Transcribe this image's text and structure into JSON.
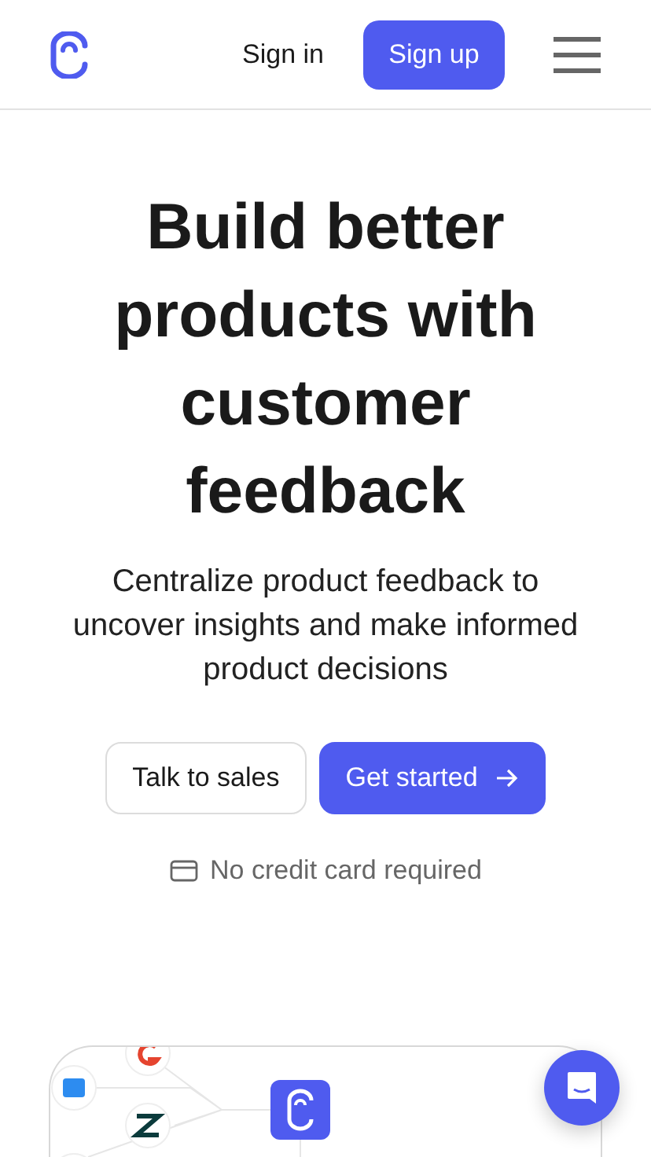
{
  "header": {
    "sign_in": "Sign in",
    "sign_up": "Sign up"
  },
  "hero": {
    "title": "Build better products with customer feedback",
    "subtitle": "Centralize product feedback to uncover insights and make informed product decisions",
    "buttons": [
      {
        "label": "Talk to sales",
        "kind": "secondary"
      },
      {
        "label": "Get started",
        "kind": "primary"
      }
    ],
    "note": "No credit card required"
  }
}
